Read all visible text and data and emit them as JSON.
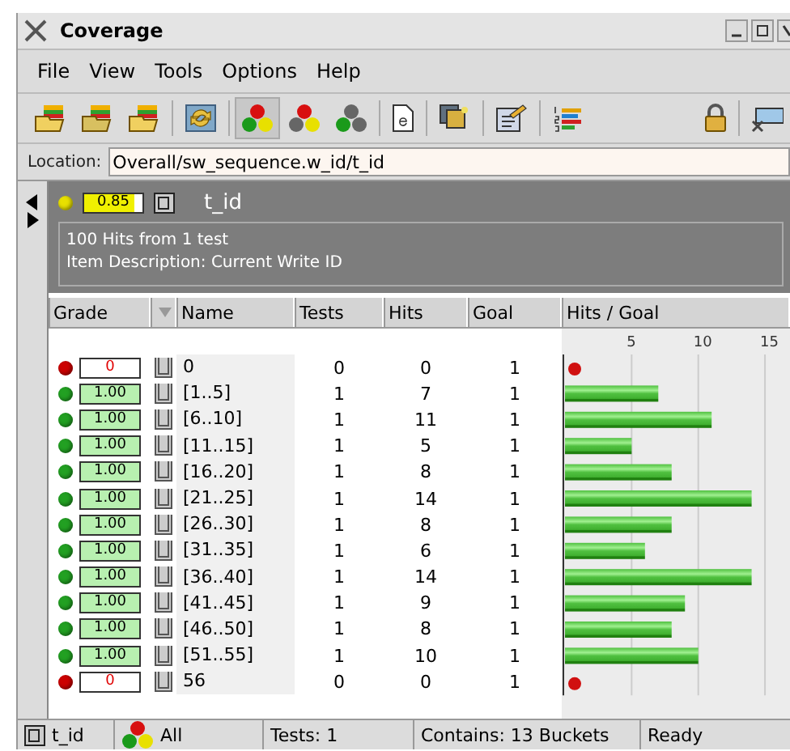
{
  "window": {
    "title": "Coverage"
  },
  "menu": [
    "File",
    "View",
    "Tools",
    "Options",
    "Help"
  ],
  "toolbar": [
    {
      "kind": "open",
      "selected": false
    },
    {
      "kind": "save",
      "selected": false
    },
    {
      "kind": "export",
      "selected": false
    },
    {
      "kind": "refresh",
      "selected": false
    },
    {
      "kind": "all-balls",
      "selected": true
    },
    {
      "kind": "red-balls",
      "selected": false
    },
    {
      "kind": "green-balls",
      "selected": false
    },
    {
      "kind": "document",
      "selected": false
    },
    {
      "kind": "copy",
      "selected": false
    },
    {
      "kind": "edit",
      "selected": false
    },
    {
      "kind": "list",
      "selected": false
    },
    {
      "kind": "lock",
      "selected": false
    },
    {
      "kind": "remove",
      "selected": false
    }
  ],
  "location": {
    "label": "Location:",
    "value": "Overall/sw_sequence.w_id/t_id"
  },
  "item": {
    "color": "#e8e000",
    "grade": "0.85",
    "level": 0.85,
    "name": "t_id",
    "summary": "100 Hits from 1 test",
    "description": "Item Description: Current Write ID"
  },
  "table": {
    "columns": [
      "Grade",
      "Name",
      "Tests",
      "Hits",
      "Goal",
      "Hits / Goal"
    ],
    "rows": [
      {
        "color": "#cc0000",
        "grade": "0",
        "level": 0,
        "name": "0",
        "tests": "0",
        "hits": "0",
        "goal": "1"
      },
      {
        "color": "#22a022",
        "grade": "1.00",
        "level": 1,
        "name": "[1..5]",
        "tests": "1",
        "hits": "7",
        "goal": "1"
      },
      {
        "color": "#22a022",
        "grade": "1.00",
        "level": 1,
        "name": "[6..10]",
        "tests": "1",
        "hits": "11",
        "goal": "1"
      },
      {
        "color": "#22a022",
        "grade": "1.00",
        "level": 1,
        "name": "[11..15]",
        "tests": "1",
        "hits": "5",
        "goal": "1"
      },
      {
        "color": "#22a022",
        "grade": "1.00",
        "level": 1,
        "name": "[16..20]",
        "tests": "1",
        "hits": "8",
        "goal": "1"
      },
      {
        "color": "#22a022",
        "grade": "1.00",
        "level": 1,
        "name": "[21..25]",
        "tests": "1",
        "hits": "14",
        "goal": "1"
      },
      {
        "color": "#22a022",
        "grade": "1.00",
        "level": 1,
        "name": "[26..30]",
        "tests": "1",
        "hits": "8",
        "goal": "1"
      },
      {
        "color": "#22a022",
        "grade": "1.00",
        "level": 1,
        "name": "[31..35]",
        "tests": "1",
        "hits": "6",
        "goal": "1"
      },
      {
        "color": "#22a022",
        "grade": "1.00",
        "level": 1,
        "name": "[36..40]",
        "tests": "1",
        "hits": "14",
        "goal": "1"
      },
      {
        "color": "#22a022",
        "grade": "1.00",
        "level": 1,
        "name": "[41..45]",
        "tests": "1",
        "hits": "9",
        "goal": "1"
      },
      {
        "color": "#22a022",
        "grade": "1.00",
        "level": 1,
        "name": "[46..50]",
        "tests": "1",
        "hits": "8",
        "goal": "1"
      },
      {
        "color": "#22a022",
        "grade": "1.00",
        "level": 1,
        "name": "[51..55]",
        "tests": "1",
        "hits": "10",
        "goal": "1"
      },
      {
        "color": "#cc0000",
        "grade": "0",
        "level": 0,
        "name": "56",
        "tests": "0",
        "hits": "0",
        "goal": "1"
      }
    ],
    "chart_data": {
      "type": "bar",
      "orientation": "horizontal",
      "grid": true,
      "values": [
        0,
        7,
        11,
        5,
        8,
        14,
        8,
        6,
        14,
        9,
        8,
        10,
        0
      ],
      "xlim": [
        0,
        17
      ],
      "xticks": [
        5,
        10,
        15
      ]
    }
  },
  "status_bar": {
    "item": "t_id",
    "filter": "All",
    "tests": "Tests: 1",
    "contains": "Contains: 13  Buckets",
    "state": "Ready"
  }
}
